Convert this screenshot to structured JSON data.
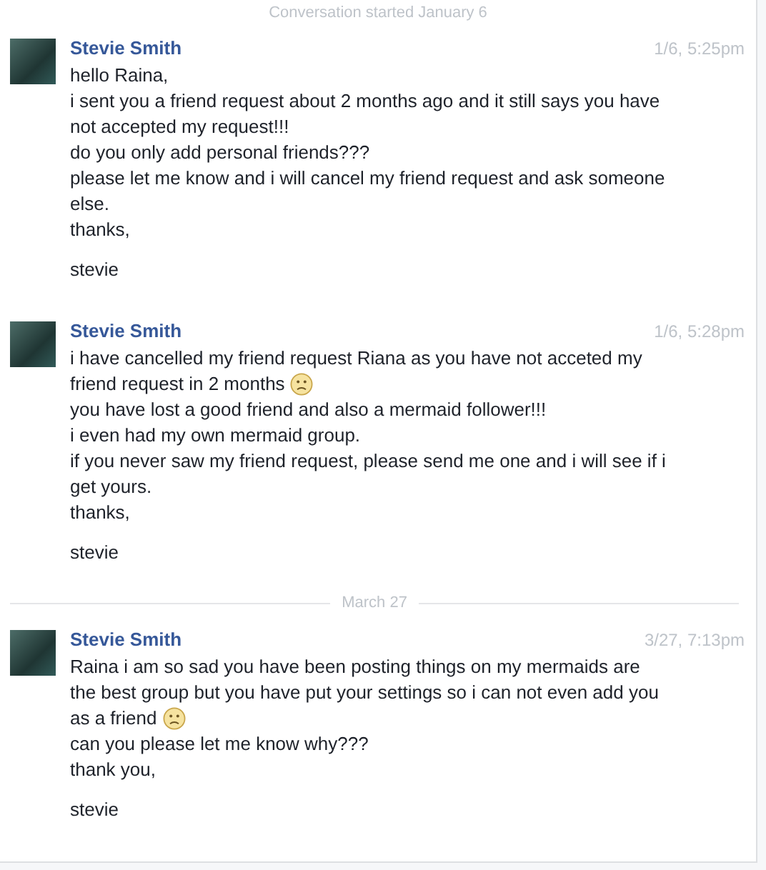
{
  "conversation_start": "Conversation started January 6",
  "items": [
    {
      "kind": "message",
      "author": "Stevie Smith",
      "time": "1/6, 5:25pm",
      "paragraphs": [
        {
          "lines": [
            "hello Raina,"
          ],
          "frown": false
        },
        {
          "lines": [
            "i sent you a friend request about 2 months ago and it still says you have",
            "not accepted my request!!!"
          ],
          "frown": false
        },
        {
          "lines": [
            "do you only add personal friends???"
          ],
          "frown": false
        },
        {
          "lines": [
            "please let me know and i will cancel my friend request and ask someone",
            "else."
          ],
          "frown": false
        },
        {
          "lines": [
            "thanks,"
          ],
          "frown": false
        }
      ],
      "signoff": "stevie"
    },
    {
      "kind": "message",
      "author": "Stevie Smith",
      "time": "1/6, 5:28pm",
      "paragraphs": [
        {
          "lines": [
            "i have cancelled my friend request Riana as you have not acceted my",
            "friend request in 2 months"
          ],
          "frown": true
        },
        {
          "lines": [
            "you have lost a good friend and also a mermaid follower!!!"
          ],
          "frown": false
        },
        {
          "lines": [
            "i even had my own mermaid group."
          ],
          "frown": false
        },
        {
          "lines": [
            "if you never saw my friend request, please send me one and i will see if i",
            "get yours."
          ],
          "frown": false
        },
        {
          "lines": [
            "thanks,"
          ],
          "frown": false
        }
      ],
      "signoff": "stevie"
    },
    {
      "kind": "divider",
      "label": "March 27"
    },
    {
      "kind": "message",
      "author": "Stevie Smith",
      "time": "3/27, 7:13pm",
      "paragraphs": [
        {
          "lines": [
            "Raina i am so sad you have been posting things on my mermaids are",
            "the best group but you have put your settings so i can not even add you",
            "as a friend"
          ],
          "frown": true
        },
        {
          "lines": [
            "can you please let me know why???"
          ],
          "frown": false
        },
        {
          "lines": [
            "thank you,"
          ],
          "frown": false
        }
      ],
      "signoff": "stevie"
    }
  ]
}
